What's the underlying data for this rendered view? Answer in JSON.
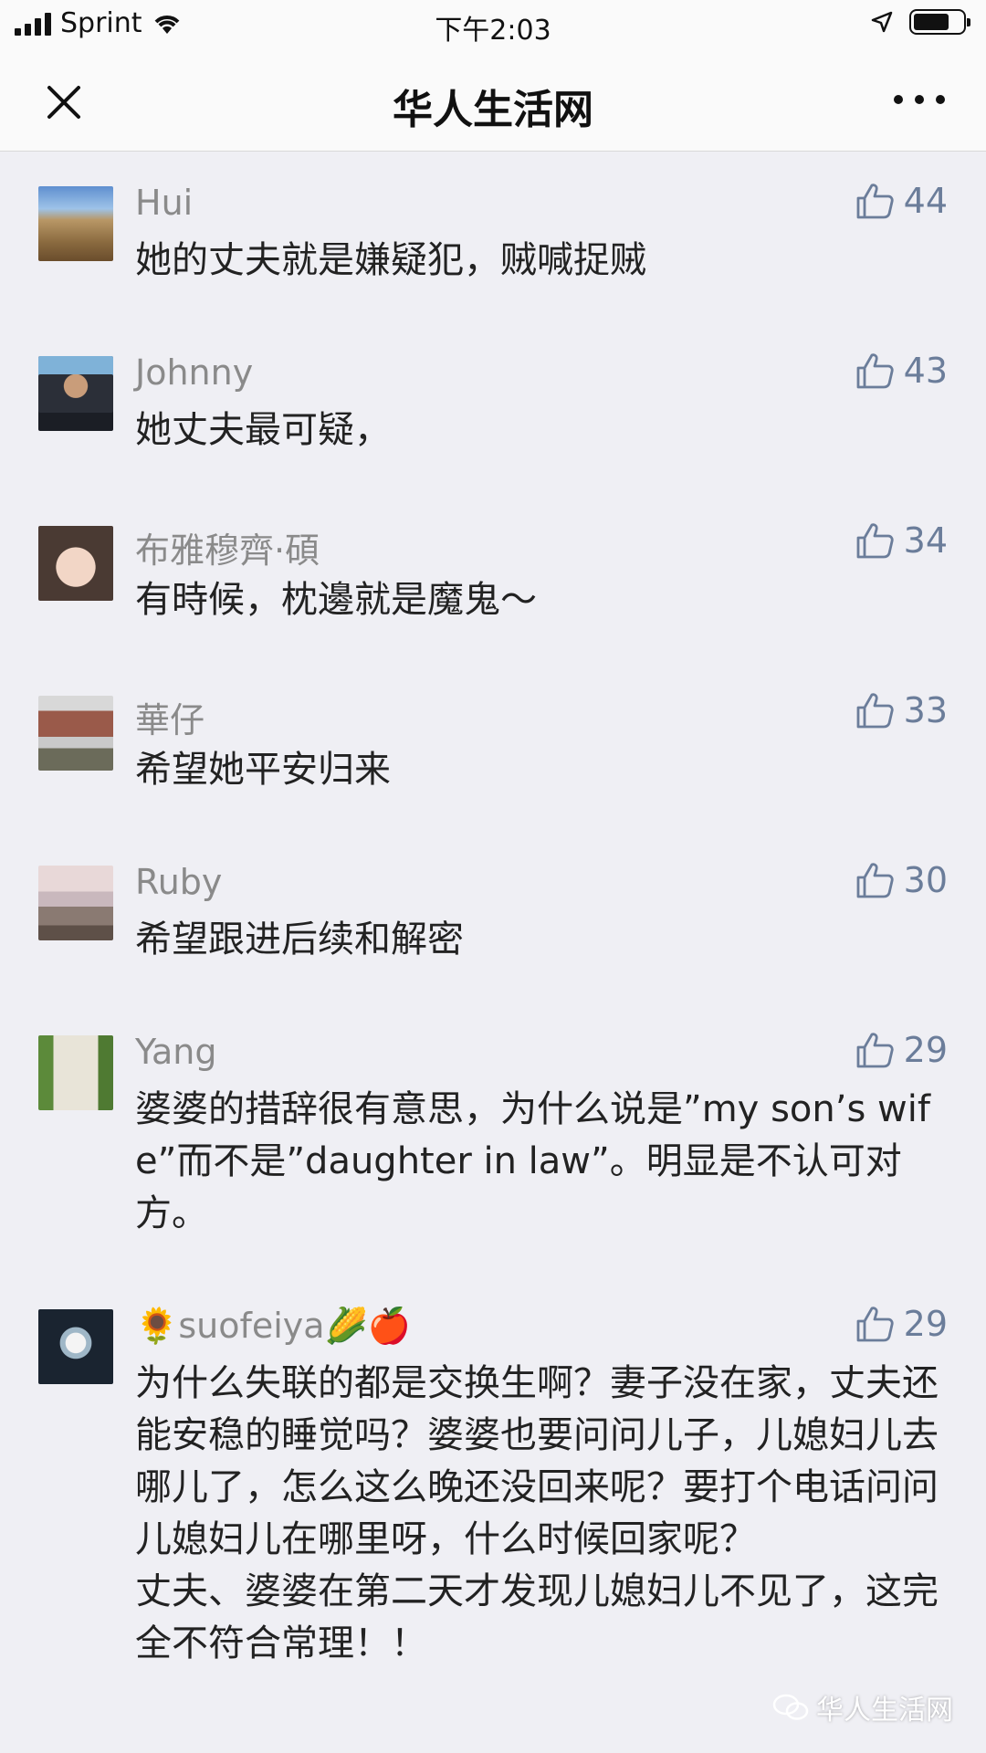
{
  "status_bar": {
    "carrier": "Sprint",
    "time": "下午2:03"
  },
  "nav": {
    "title": "华人生活网"
  },
  "comments": [
    {
      "user": "Hui",
      "likes": "44",
      "text": "她的丈夫就是嫌疑犯，贼喊捉贼"
    },
    {
      "user": "Johnny",
      "likes": "43",
      "text": "她丈夫最可疑，"
    },
    {
      "user": "布雅穆齊·碩",
      "likes": "34",
      "text": "有時候，枕邊就是魔鬼～"
    },
    {
      "user": "華仔",
      "likes": "33",
      "text": "希望她平安归来"
    },
    {
      "user": "Ruby",
      "likes": "30",
      "text": "希望跟进后续和解密"
    },
    {
      "user": "Yang",
      "likes": "29",
      "text": "婆婆的措辞很有意思，为什么说是”my son’s wife”而不是”daughter in law”。明显是不认可对方。"
    },
    {
      "user": "🌻suofeiya🌽🍎",
      "likes": "29",
      "text": "为什么失联的都是交换生啊？妻子没在家，丈夫还能安稳的睡觉吗？婆婆也要问问儿子，儿媳妇儿去哪儿了，怎么这么晚还没回来呢？要打个电话问问儿媳妇儿在哪里呀，什么时候回家呢？\n丈夫、婆婆在第二天才发现儿媳妇儿不见了，这完全不符合常理！！"
    }
  ],
  "watermark": {
    "text": "华人生活网"
  },
  "colors": {
    "background": "#efeff4",
    "like": "#6b7d9a",
    "username": "#8a8a8a"
  }
}
